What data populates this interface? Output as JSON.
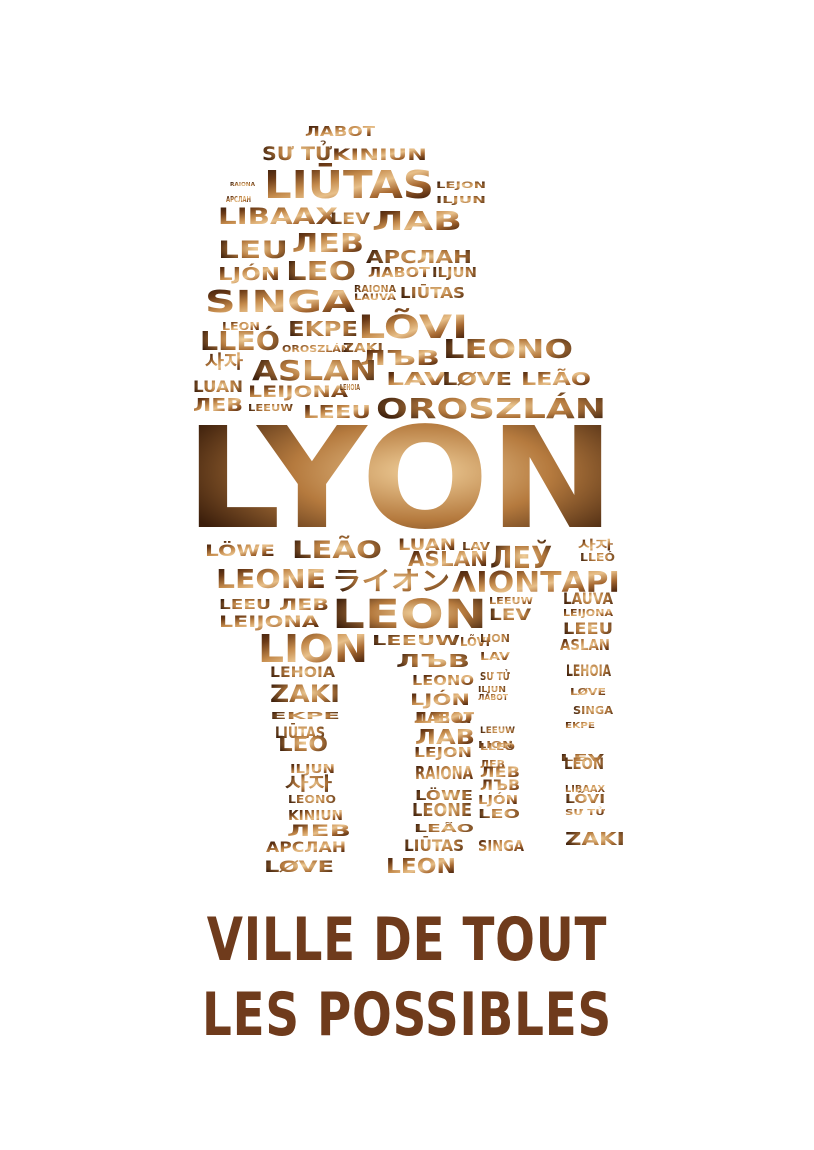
{
  "lion_words": {
    "main": "LYON",
    "words": [
      "ЛАВОТ",
      "SƯ TỬ",
      "KINIUN",
      "RAIONA",
      "LIŪTAS",
      "LEJON",
      "АРСЛАН",
      "ILJUN",
      "LIBAAX",
      "LEV",
      "ЛАВ",
      "LEU",
      "ЛЕВ",
      "АРСЛАН",
      "LJÓN",
      "LEO",
      "ЛАВОТ",
      "ILJUN",
      "SINGA",
      "RAIONA",
      "LAUVA",
      "LIŪTAS",
      "LEON",
      "EKPE",
      "LÕVI",
      "LLEÓ",
      "OROSZLÁN",
      "ZAKI",
      "ЛЪВ",
      "LEONO",
      "사자",
      "ASLAN",
      "LAV",
      "LØVE",
      "LEÃO",
      "LUAN",
      "LEIJONA",
      "LEHOIA",
      "ЛЕВ",
      "LEEUW",
      "LEEU",
      "OROSZLÁN",
      "LÖWE",
      "LEÃO",
      "LUAN",
      "LAV",
      "ASLAN",
      "ЛЕЎ",
      "사자",
      "LLEÓ",
      "LEONE",
      "ライオン",
      "ΛΙΟΝΤΑΡΙ",
      "LEEU",
      "ЛЕВ",
      "LEON",
      "LEEUW",
      "LAUVA",
      "LEIJONA",
      "LEV",
      "LEIJONA",
      "LEEU",
      "LION",
      "LEEUW",
      "LÕVI",
      "LION",
      "ASLAN",
      "ЛЪВ",
      "LEONO",
      "LEHOIA",
      "LAV",
      "LEHOIA",
      "LJÓN",
      "SƯ TỬ",
      "LØVE",
      "ZAKI",
      "ЛАВОТ",
      "ILJUN",
      "ЛАВОТ",
      "EKPE",
      "LEU",
      "SINGA",
      "ЛАВ",
      "LIŪTAS",
      "EKPE",
      "LEO",
      "LEJON",
      "LEEUW",
      "ILJUN",
      "LION",
      "LLEÓ",
      "LEV",
      "RAIONA",
      "LEON",
      "ЛЕВ",
      "사자",
      "ЛЕВ",
      "LÖWE",
      "ЛЪВ",
      "LEONO",
      "LIBAAX",
      "LEONE",
      "LJÓN",
      "LÕVI",
      "KINIUN",
      "LEÃO",
      "ЛЕВ",
      "LEO",
      "SƯ TỬ",
      "LIŪTAS",
      "SINGA",
      "ZAKI",
      "АРСЛАН",
      "LØVE",
      "LEON"
    ]
  },
  "tagline": {
    "line1": "VILLE DE TOUT",
    "line2": "LES POSSIBLES"
  },
  "colors": {
    "fur_light": "#dfb37a",
    "fur_mid": "#b97a3d",
    "fur_dark": "#3a1e0c",
    "tagline": "#6f3b1c"
  }
}
